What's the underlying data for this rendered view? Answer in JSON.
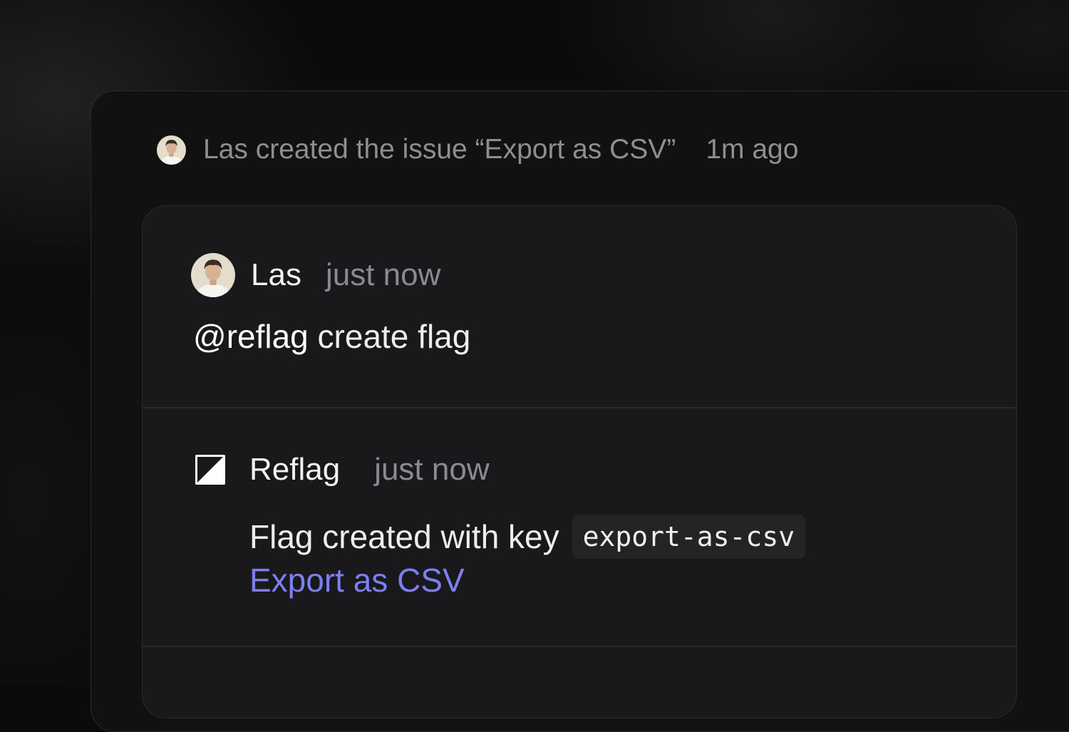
{
  "activity": {
    "text": "Las created the issue “Export as CSV”",
    "time": "1m ago"
  },
  "comment": {
    "author": "Las",
    "time": "just now",
    "mention": "@reflag",
    "text": " create flag"
  },
  "reply": {
    "author": "Reflag",
    "time": "just now",
    "message": "Flag created with key",
    "flag_key": "export-as-csv",
    "link_label": "Export as CSV"
  },
  "colors": {
    "accent_link": "#7b7ff0",
    "card_bg": "#19191b",
    "panel_bg": "#111112"
  },
  "icons": {
    "user_avatar": "avatar",
    "reflag_logo": "reflag-logo-icon"
  }
}
